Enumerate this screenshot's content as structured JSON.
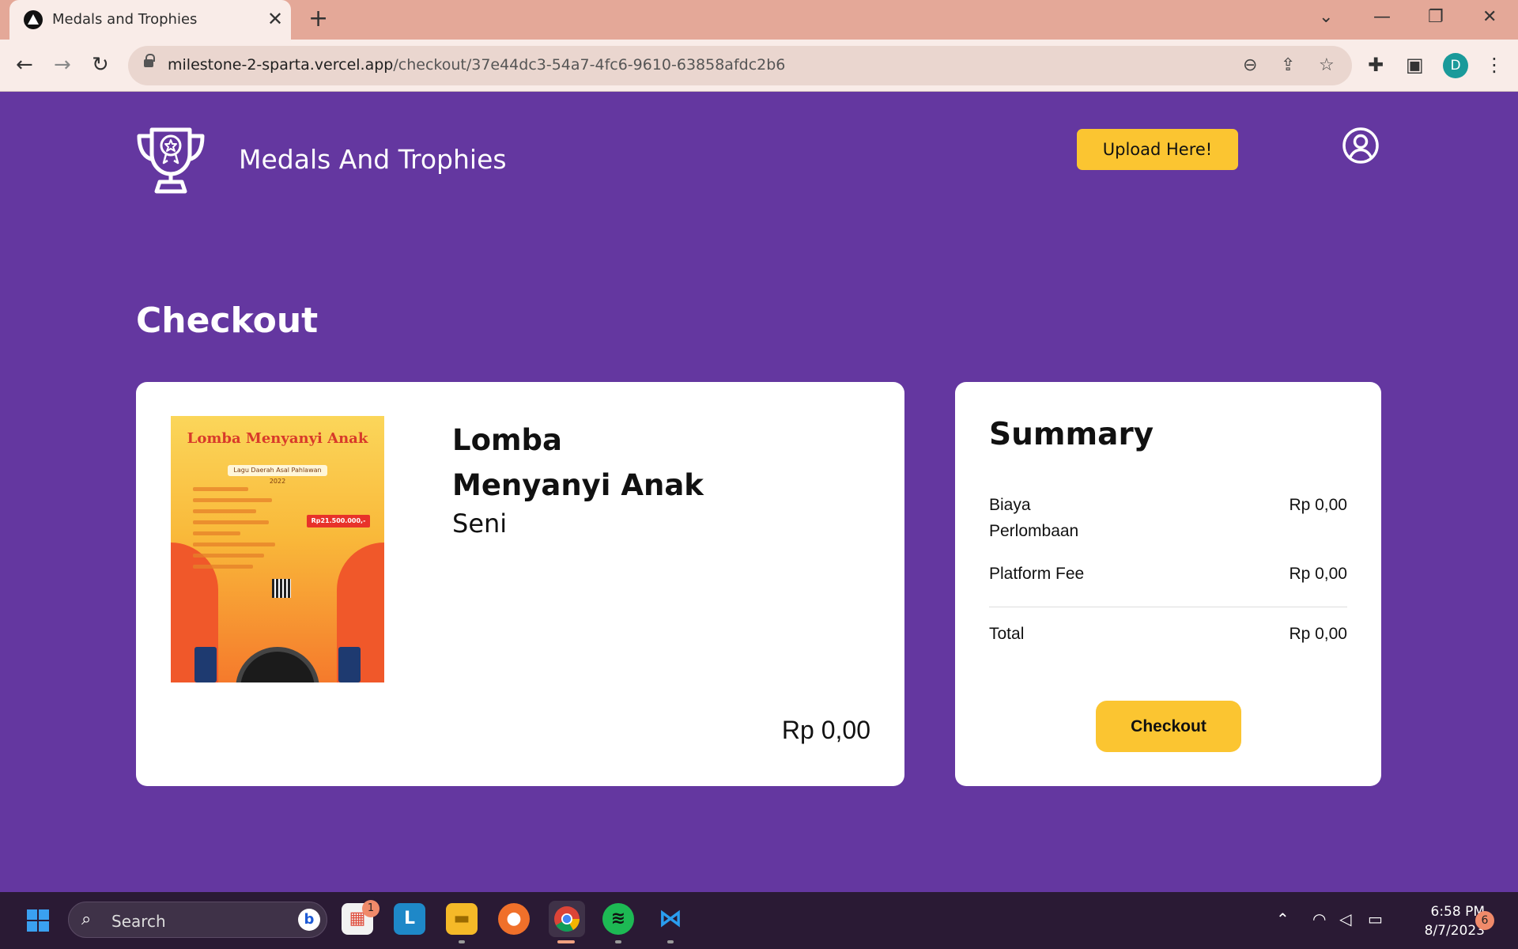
{
  "browser": {
    "tab_title": "Medals and Trophies",
    "url_host": "milestone-2-sparta.vercel.app",
    "url_path": "/checkout/37e44dc3-54a7-4fc6-9610-63858afdc2b6",
    "profile_initial": "D"
  },
  "header": {
    "site_title": "Medals And Trophies",
    "upload_label": "Upload Here!"
  },
  "page": {
    "title": "Checkout"
  },
  "item": {
    "name": "Lomba Menyanyi Anak",
    "category": "Seni",
    "price": "Rp 0,00",
    "poster": {
      "title": "Lomba Menyanyi Anak",
      "subtitle": "Lagu Daerah Asal Pahlawan 2022",
      "price_tag": "Rp21.500.000,-"
    }
  },
  "summary": {
    "title": "Summary",
    "rows": [
      {
        "label": "Biaya Perlombaan",
        "value": "Rp 0,00"
      },
      {
        "label": "Platform Fee",
        "value": "Rp 0,00"
      }
    ],
    "total_label": "Total",
    "total_value": "Rp 0,00",
    "checkout_label": "Checkout"
  },
  "taskbar": {
    "search_placeholder": "Search",
    "store_badge": "1",
    "time": "6:58 PM",
    "date": "8/7/2023",
    "notification_count": "6"
  },
  "colors": {
    "page_bg": "#6437a0",
    "accent": "#fbc531",
    "card_bg": "#ffffff"
  }
}
